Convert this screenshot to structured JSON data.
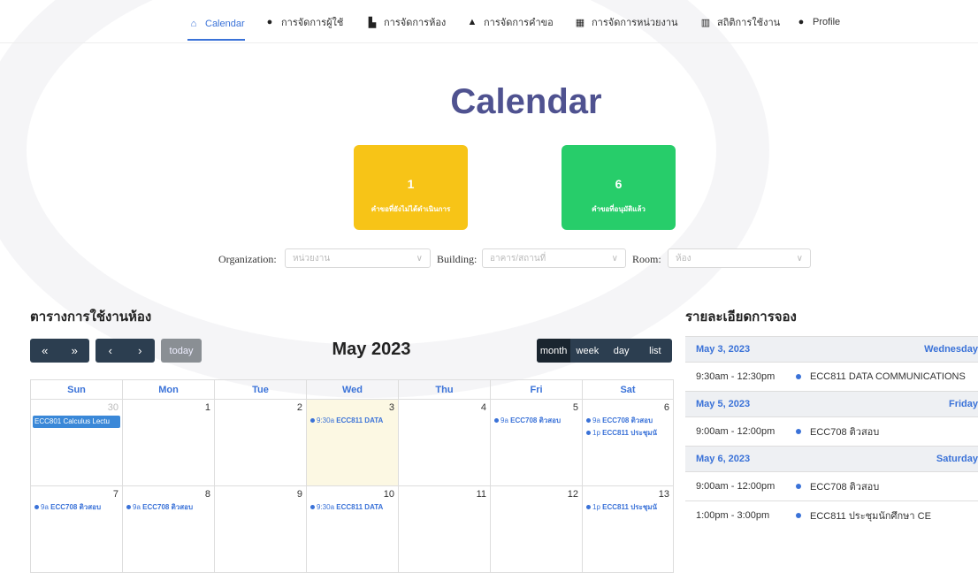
{
  "nav": {
    "items": [
      {
        "label": "Calendar",
        "icon": "home-icon"
      },
      {
        "label": "การจัดการผู้ใช้",
        "icon": "users-icon"
      },
      {
        "label": "การจัดการห้อง",
        "icon": "room-icon"
      },
      {
        "label": "การจัดการคำขอ",
        "icon": "bell-icon"
      },
      {
        "label": "การจัดการหน่วยงาน",
        "icon": "building-icon"
      },
      {
        "label": "สถิติการใช้งาน",
        "icon": "chart-icon"
      },
      {
        "label": "Profile",
        "icon": "user-icon"
      }
    ]
  },
  "page": {
    "title": "Calendar"
  },
  "stats": {
    "pending": {
      "value": "1",
      "label": "คำขอที่ยังไม่ได้ดำเนินการ",
      "color": "#f7c417"
    },
    "approved": {
      "value": "6",
      "label": "คำขอที่อนุมัติแล้ว",
      "color": "#27cd6a"
    }
  },
  "filters": {
    "organization": {
      "label": "Organization:",
      "placeholder": "หน่วยงาน"
    },
    "building": {
      "label": "Building:",
      "placeholder": "อาคาร/สถานที่"
    },
    "room": {
      "label": "Room:",
      "placeholder": "ห้อง"
    }
  },
  "calendar": {
    "section_title": "ตารางการใช้งานห้อง",
    "prev_year": "«",
    "next_year": "»",
    "prev": "‹",
    "next": "›",
    "today_label": "today",
    "title": "May 2023",
    "views": [
      "month",
      "week",
      "day",
      "list"
    ],
    "weekdays": [
      "Sun",
      "Mon",
      "Tue",
      "Wed",
      "Thu",
      "Fri",
      "Sat"
    ],
    "weeks": [
      [
        {
          "day": "30",
          "other": true,
          "block": "ECC801 Calculus Lectu"
        },
        {
          "day": "1"
        },
        {
          "day": "2"
        },
        {
          "day": "3",
          "today": true,
          "events": [
            {
              "time": "9:30a",
              "title": "ECC811 DATA"
            }
          ]
        },
        {
          "day": "4"
        },
        {
          "day": "5",
          "events": [
            {
              "time": "9a",
              "title": "ECC708 ติวสอบ"
            }
          ]
        },
        {
          "day": "6",
          "events": [
            {
              "time": "9a",
              "title": "ECC708 ติวสอบ"
            },
            {
              "time": "1p",
              "title": "ECC811 ประชุมนั"
            }
          ]
        }
      ],
      [
        {
          "day": "7",
          "events": [
            {
              "time": "9a",
              "title": "ECC708 ติวสอบ"
            }
          ]
        },
        {
          "day": "8",
          "events": [
            {
              "time": "9a",
              "title": "ECC708 ติวสอบ"
            }
          ]
        },
        {
          "day": "9"
        },
        {
          "day": "10",
          "events": [
            {
              "time": "9:30a",
              "title": "ECC811 DATA"
            }
          ]
        },
        {
          "day": "11"
        },
        {
          "day": "12"
        },
        {
          "day": "13",
          "events": [
            {
              "time": "1p",
              "title": "ECC811 ประชุมนั"
            }
          ]
        }
      ]
    ]
  },
  "details": {
    "section_title": "รายละเอียดการจอง",
    "groups": [
      {
        "date": "May 3, 2023",
        "weekday": "Wednesday",
        "rows": [
          {
            "time": "9:30am - 12:30pm",
            "title": "ECC811 DATA COMMUNICATIONS"
          }
        ]
      },
      {
        "date": "May 5, 2023",
        "weekday": "Friday",
        "rows": [
          {
            "time": "9:00am - 12:00pm",
            "title": "ECC708 ติวสอบ"
          }
        ]
      },
      {
        "date": "May 6, 2023",
        "weekday": "Saturday",
        "rows": [
          {
            "time": "9:00am - 12:00pm",
            "title": "ECC708 ติวสอบ"
          },
          {
            "time": "1:00pm - 3:00pm",
            "title": "ECC811 ประชุมนักศึกษา CE"
          }
        ]
      }
    ]
  }
}
